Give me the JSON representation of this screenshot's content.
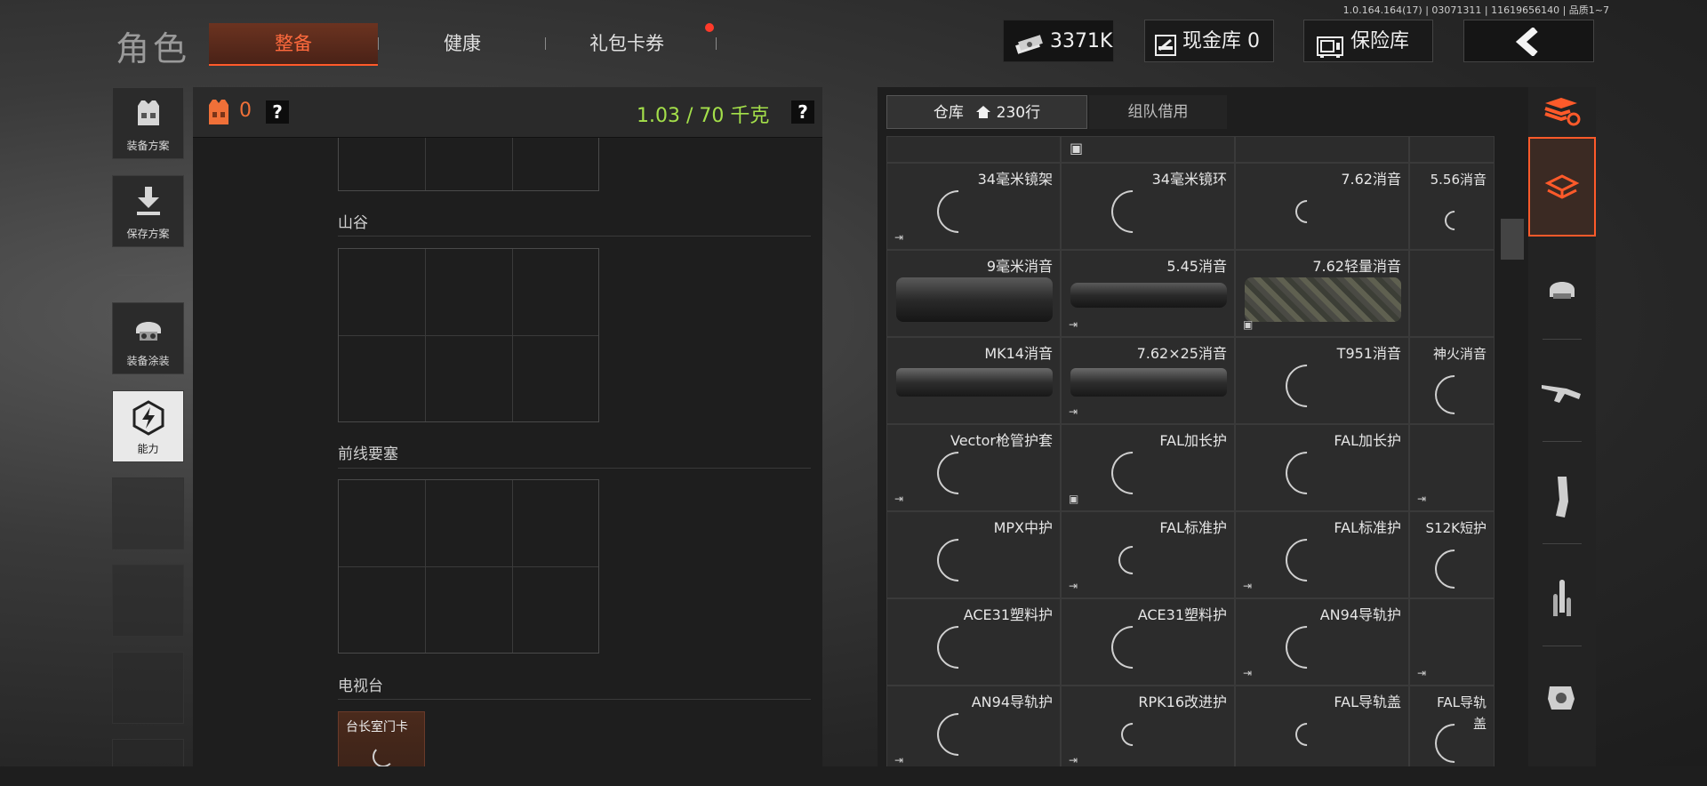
{
  "version": "1.0.164.164(17) | 03071311 | 11619656140 | 品质1~7",
  "page_title": "角色",
  "tabs": [
    {
      "label": "整备"
    },
    {
      "label": "健康"
    },
    {
      "label": "礼包卡券"
    }
  ],
  "currency": {
    "money": "3371K",
    "cash_label": "现金库 0",
    "safe_label": "保险库"
  },
  "sidebar": {
    "loadout_plan": "装备方案",
    "save_plan": "保存方案",
    "skin": "装备涂装",
    "ability": "能力"
  },
  "left_panel": {
    "armor_count": "0",
    "help": "?",
    "weight": "1.03 / 70 千克"
  },
  "sections": [
    {
      "title": "山谷"
    },
    {
      "title": "前线要塞"
    },
    {
      "title": "电视台"
    }
  ],
  "keycard": "台长室门卡",
  "right_tabs": {
    "warehouse": "仓库",
    "rows": "230行",
    "team_borrow": "组队借用"
  },
  "items": [
    [
      "34毫米镜架",
      "34毫米镜环",
      "7.62消音",
      "5.56消音"
    ],
    [
      "9毫米消音",
      "5.45消音",
      "7.62轻量消音",
      ""
    ],
    [
      "MK14消音",
      "7.62×25消音",
      "T951消音",
      "神火消音"
    ],
    [
      "Vector枪管护套",
      "FAL加长护",
      "FAL加长护",
      ""
    ],
    [
      "MPX中护",
      "FAL标准护",
      "FAL标准护",
      "S12K短护"
    ],
    [
      "ACE31塑料护",
      "ACE31塑料护",
      "AN94导轨护",
      ""
    ],
    [
      "AN94导轨护",
      "RPK16改进护",
      "FAL导轨盖",
      "FAL导轨盖"
    ]
  ],
  "icons": [
    "cash-stack-icon",
    "cash-vault-icon",
    "safe-icon",
    "back-arrow-icon",
    "vest-icon",
    "download-icon",
    "helmet-icon",
    "ability-icon",
    "home-icon",
    "exit-icon",
    "box-icon"
  ],
  "accent": "#ff5a2a",
  "weight_color": "#a4e04a"
}
